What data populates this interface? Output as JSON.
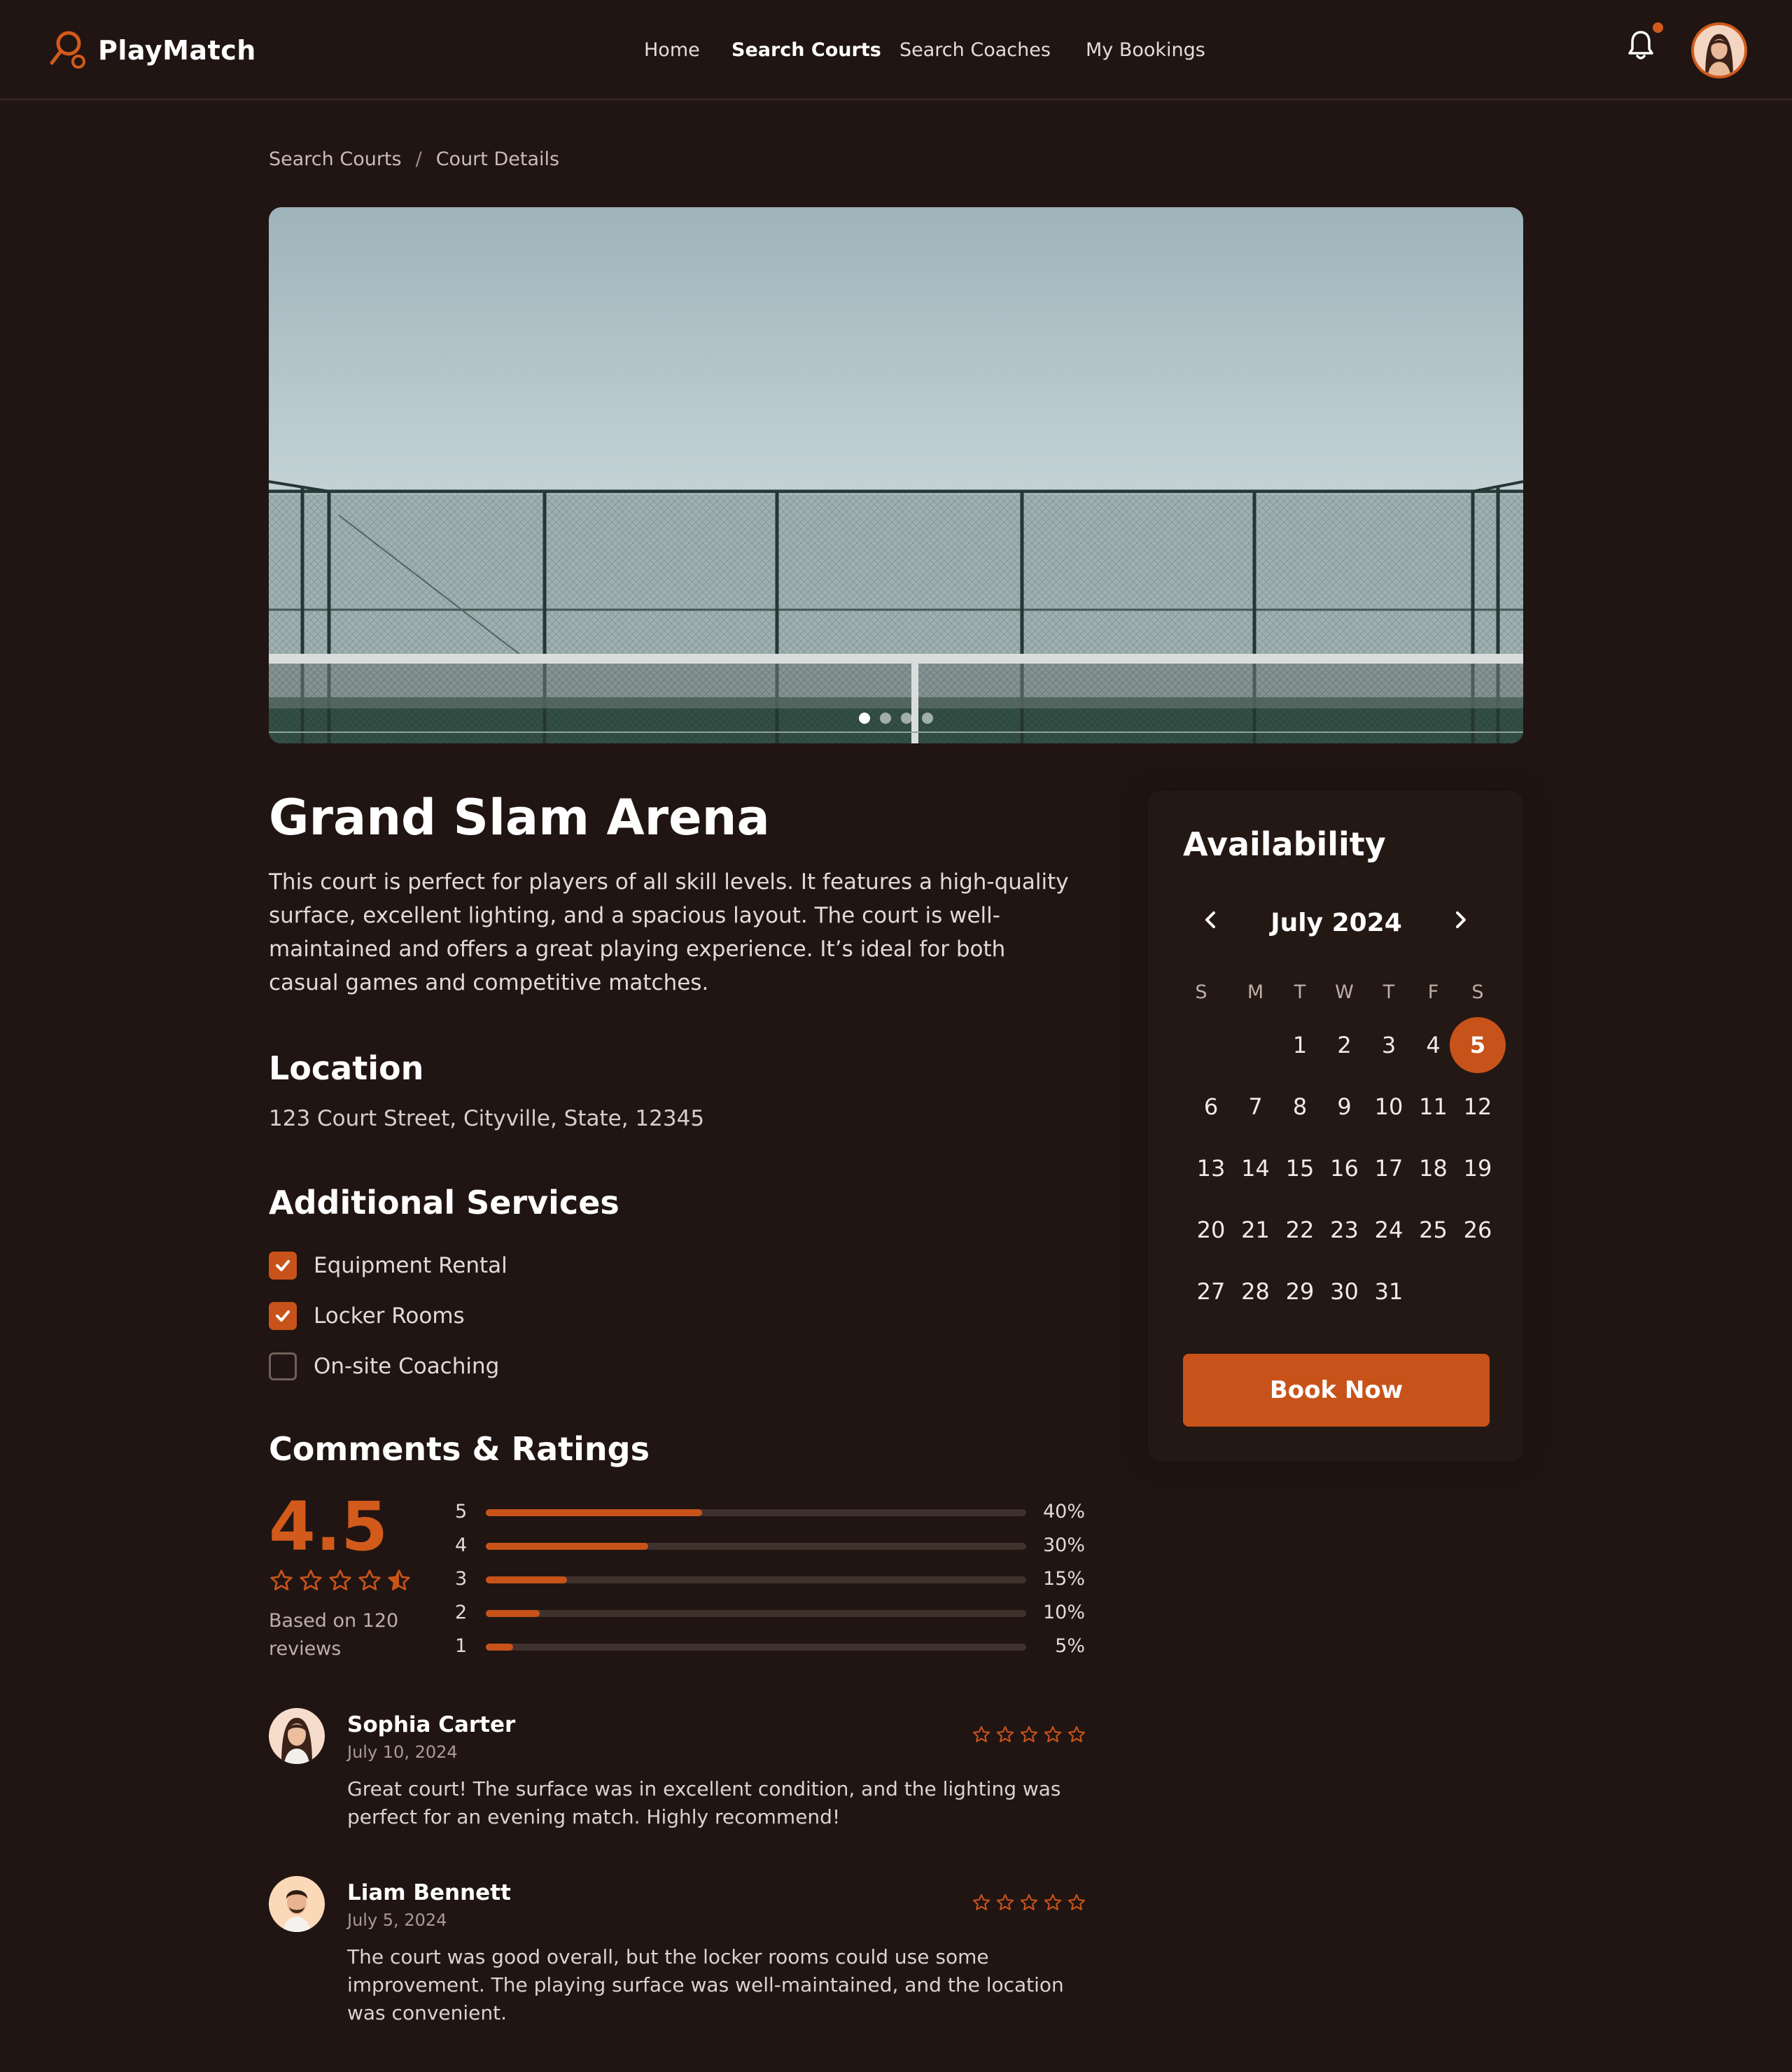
{
  "app": {
    "name": "PlayMatch"
  },
  "nav": {
    "items": [
      {
        "label": "Home",
        "active": false
      },
      {
        "label": "Search Courts",
        "active": true
      },
      {
        "label": "Search Coaches",
        "active": false
      },
      {
        "label": "My Bookings",
        "active": false
      }
    ]
  },
  "header": {
    "notification_icon": "bell-icon",
    "has_notification": true
  },
  "breadcrumb": {
    "items": [
      "Search Courts",
      "Court Details"
    ],
    "separator": "/"
  },
  "hero": {
    "slides": 4,
    "active_slide": 1
  },
  "court": {
    "name": "Grand Slam Arena",
    "description": "This court is perfect for players of all skill levels. It features a high-quality surface, excellent lighting, and a spacious layout. The court is well-maintained and offers a great playing experience. It’s ideal for both casual games and competitive matches."
  },
  "location": {
    "heading": "Location",
    "address": "123 Court Street, Cityville, State, 12345"
  },
  "services": {
    "heading": "Additional Services",
    "items": [
      {
        "label": "Equipment Rental",
        "checked": true
      },
      {
        "label": "Locker Rooms",
        "checked": true
      },
      {
        "label": "On-site Coaching",
        "checked": false
      }
    ]
  },
  "ratings": {
    "heading": "Comments & Ratings",
    "average": "4.5",
    "average_stars": 4.5,
    "based_on": "Based on 120 reviews",
    "distribution": [
      {
        "stars": "5",
        "percent": 40,
        "label": "40%"
      },
      {
        "stars": "4",
        "percent": 30,
        "label": "30%"
      },
      {
        "stars": "3",
        "percent": 15,
        "label": "15%"
      },
      {
        "stars": "2",
        "percent": 10,
        "label": "10%"
      },
      {
        "stars": "1",
        "percent": 5,
        "label": "5%"
      }
    ]
  },
  "reviews": [
    {
      "name": "Sophia Carter",
      "date": "July 10, 2024",
      "stars": 5,
      "text": "Great court! The surface was in excellent condition, and the lighting was perfect for an evening match. Highly recommend!"
    },
    {
      "name": "Liam Bennett",
      "date": "July 5, 2024",
      "stars": 5,
      "text": "The court was good overall, but the locker rooms could use some improvement. The playing surface was well-maintained, and the location was convenient."
    }
  ],
  "availability": {
    "heading": "Availability",
    "month": "July 2024",
    "weekdays": [
      "S",
      "M",
      "T",
      "W",
      "T",
      "F",
      "S"
    ],
    "first_weekday_index": 2,
    "days_in_month": 31,
    "selected_day": 5,
    "book_label": "Book Now"
  },
  "colors": {
    "accent": "#c8531a",
    "background": "#201512"
  }
}
